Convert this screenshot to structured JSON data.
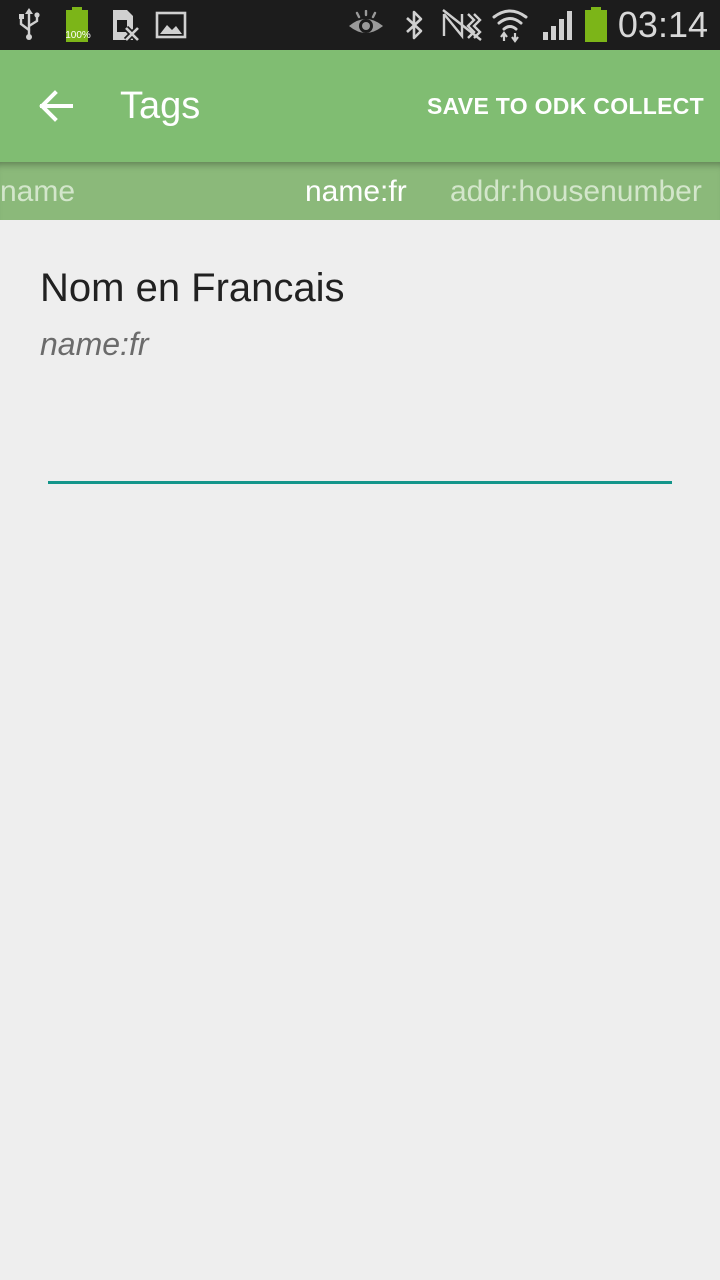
{
  "status_bar": {
    "time": "03:14",
    "battery_badge": "100%",
    "icons_left": [
      "usb-icon",
      "battery-full-icon",
      "no-sim-icon",
      "gallery-icon"
    ],
    "icons_right": [
      "eye-icon",
      "bluetooth-icon",
      "nfc-muted-icon",
      "wifi-icon",
      "cell-signal-icon",
      "battery-icon"
    ]
  },
  "action_bar": {
    "title": "Tags",
    "back_icon": "arrow-left-icon",
    "save_label": "SAVE TO ODK COLLECT"
  },
  "tabs": [
    {
      "label": "name",
      "active": false
    },
    {
      "label": "name:fr",
      "active": true
    },
    {
      "label": "addr:housenumber",
      "active": false
    }
  ],
  "field": {
    "label": "Nom en Francais",
    "key": "name:fr",
    "value": "",
    "placeholder": ""
  },
  "colors": {
    "status_bar": "#1c1c1c",
    "action_bar": "#80bd72",
    "tab_strip": "#8bb97a",
    "background": "#eeeeee",
    "input_underline": "#13958a",
    "battery_green": "#7cb518"
  }
}
